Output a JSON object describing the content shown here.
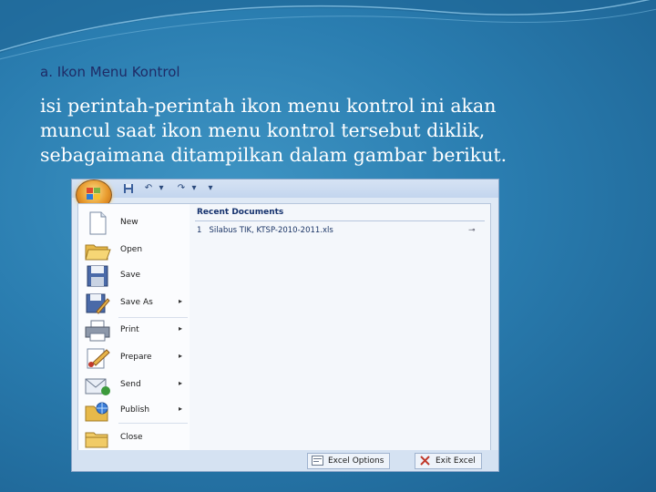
{
  "slide": {
    "heading": "a. Ikon Menu Kontrol",
    "body_lines": [
      "isi perintah-perintah ikon menu kontrol ini akan",
      "muncul saat ikon menu kontrol tersebut diklik,",
      "sebagaimana ditampilkan dalam gambar berikut."
    ]
  },
  "office_menu": {
    "items": [
      {
        "label": "New",
        "icon": "new-document-icon",
        "submenu": false
      },
      {
        "label": "Open",
        "icon": "open-folder-icon",
        "submenu": false
      },
      {
        "label": "Save",
        "icon": "floppy-disk-icon",
        "submenu": false
      },
      {
        "label": "Save As",
        "icon": "save-as-icon",
        "submenu": true
      },
      {
        "label": "Print",
        "icon": "printer-icon",
        "submenu": true
      },
      {
        "label": "Prepare",
        "icon": "prepare-icon",
        "submenu": true
      },
      {
        "label": "Send",
        "icon": "send-icon",
        "submenu": true
      },
      {
        "label": "Publish",
        "icon": "publish-icon",
        "submenu": true
      },
      {
        "label": "Close",
        "icon": "close-folder-icon",
        "submenu": false
      }
    ],
    "submenu_arrow": "▸",
    "recent": {
      "heading": "Recent Documents",
      "items": [
        {
          "number": "1",
          "name": "Silabus TIK, KTSP-2010-2011.xls"
        }
      ]
    },
    "buttons": {
      "options": "Excel Options",
      "exit": "Exit Excel"
    }
  }
}
